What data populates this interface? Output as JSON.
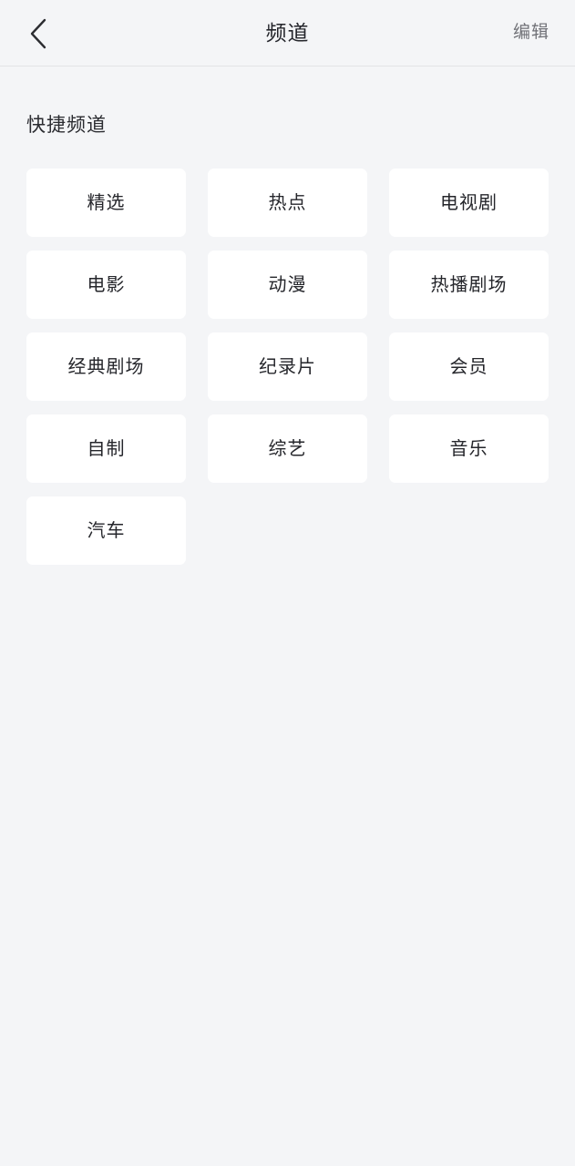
{
  "header": {
    "back_icon": "chevron-left-icon",
    "title": "频道",
    "action_label": "编辑"
  },
  "section": {
    "title": "快捷频道"
  },
  "channels": [
    {
      "label": "精选"
    },
    {
      "label": "热点"
    },
    {
      "label": "电视剧"
    },
    {
      "label": "电影"
    },
    {
      "label": "动漫"
    },
    {
      "label": "热播剧场"
    },
    {
      "label": "经典剧场"
    },
    {
      "label": "纪录片"
    },
    {
      "label": "会员"
    },
    {
      "label": "自制"
    },
    {
      "label": "综艺"
    },
    {
      "label": "音乐"
    },
    {
      "label": "汽车"
    }
  ],
  "colors": {
    "page_background": "#f4f5f7",
    "tile_background": "#ffffff",
    "title_text": "#23242a",
    "action_text": "#707177",
    "divider": "#e2e3e6"
  }
}
